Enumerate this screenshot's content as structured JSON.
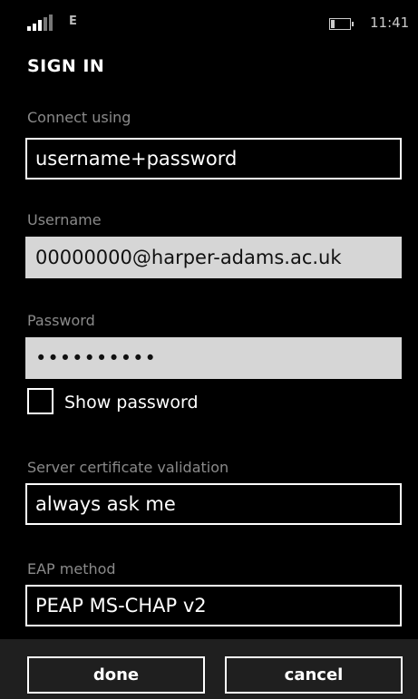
{
  "status_bar": {
    "signal_icon": "signal-strength-icon",
    "network_type": "E",
    "battery_icon": "battery-icon",
    "time": "11:41"
  },
  "page": {
    "title": "SIGN IN"
  },
  "form": {
    "connect_using": {
      "label": "Connect using",
      "value": "username+password"
    },
    "username": {
      "label": "Username",
      "value": "00000000@harper-adams.ac.uk"
    },
    "password": {
      "label": "Password",
      "value": "••••••••••"
    },
    "show_password": {
      "label": "Show password",
      "checked": false
    },
    "server_cert": {
      "label": "Server certificate validation",
      "value": "always ask me"
    },
    "eap_method": {
      "label": "EAP method",
      "value": "PEAP MS-CHAP v2"
    }
  },
  "app_bar": {
    "done_label": "done",
    "cancel_label": "cancel"
  }
}
